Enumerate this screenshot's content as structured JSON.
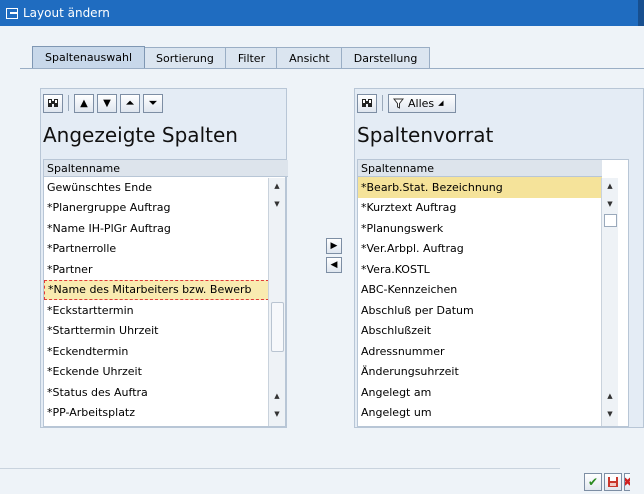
{
  "window": {
    "title": "Layout ändern"
  },
  "tabs": [
    {
      "label": "Spaltenauswahl"
    },
    {
      "label": "Sortierung"
    },
    {
      "label": "Filter"
    },
    {
      "label": "Ansicht"
    },
    {
      "label": "Darstellung"
    }
  ],
  "left_panel": {
    "heading": "Angezeigte Spalten",
    "column_header": "Spaltenname",
    "rows": [
      "Gewünschtes Ende",
      "*Planergruppe Auftrag",
      "*Name IH-PlGr Auftrag",
      "*Partnerrolle",
      "*Partner",
      "*Name des Mitarbeiters bzw. Bewerb",
      "*Eckstarttermin",
      "*Starttermin Uhrzeit",
      "*Eckendtermin",
      "*Eckende Uhrzeit",
      "*Status des Auftra",
      "*PP-Arbeitsplatz"
    ]
  },
  "right_panel": {
    "heading": "Spaltenvorrat",
    "column_header": "Spaltenname",
    "filter_label": "Alles",
    "rows": [
      "*Bearb.Stat. Bezeichnung",
      "*Kurztext Auftrag",
      "*Planungswerk",
      "*Ver.Arbpl. Auftrag",
      "*Vera.KOSTL",
      "ABC-Kennzeichen",
      "Abschluß per Datum",
      "Abschlußzeit",
      "Adressnummer",
      "Änderungsuhrzeit",
      "Angelegt am",
      "Angelegt um"
    ]
  },
  "icons": {
    "find": "find-icon",
    "up": "arrow-up-icon",
    "down": "arrow-down-icon",
    "top": "arrow-top-icon",
    "bottom": "arrow-bottom-icon",
    "filter": "filter-icon",
    "move_right": "move-right-icon",
    "move_left": "move-left-icon",
    "confirm": "checkmark-icon",
    "save": "save-icon",
    "cancel": "cancel-icon"
  },
  "colors": {
    "titlebar": "#1f6cc0",
    "selected_row": "#f5e39a",
    "focus_border": "#e03a3a"
  }
}
